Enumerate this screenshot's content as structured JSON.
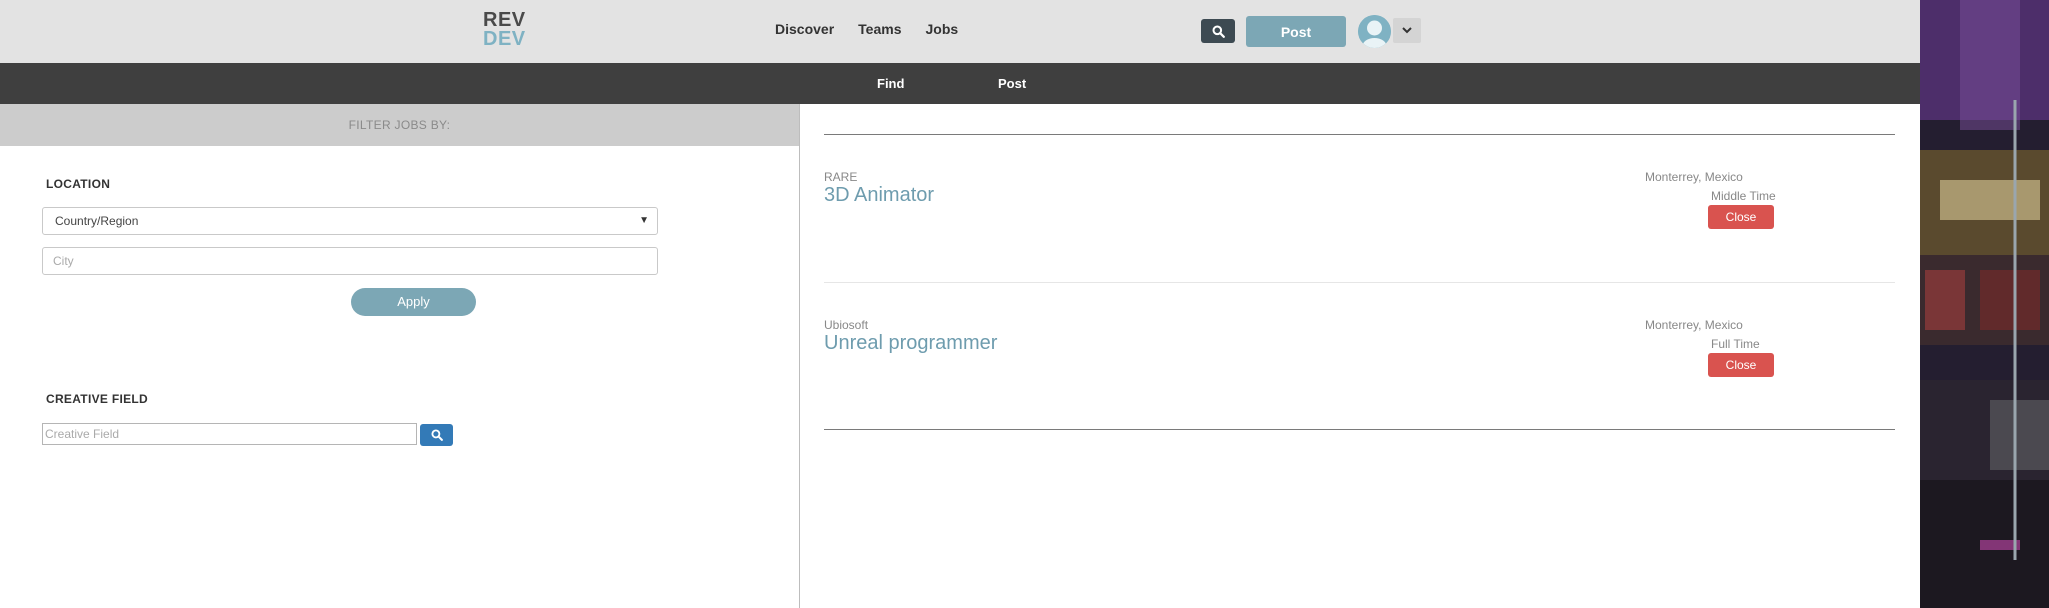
{
  "header": {
    "logo_line1": "REV",
    "logo_line2": "DEV",
    "nav": [
      "Discover",
      "Teams",
      "Jobs"
    ],
    "post_label": "Post"
  },
  "subnav": {
    "find": "Find",
    "post": "Post"
  },
  "filters": {
    "heading": "FILTER JOBS BY:",
    "location_label": "LOCATION",
    "country_select": "Country/Region",
    "city_placeholder": "City",
    "apply_label": "Apply",
    "creative_label": "CREATIVE FIELD",
    "creative_placeholder": "Creative Field"
  },
  "jobs": [
    {
      "company": "RARE",
      "title": "3D Animator",
      "location": "Monterrey, Mexico",
      "time": "Middle Time",
      "action": "Close"
    },
    {
      "company": "Ubiosoft",
      "title": "Unreal programmer",
      "location": "Monterrey, Mexico",
      "time": "Full Time",
      "action": "Close"
    }
  ],
  "colors": {
    "accent": "#7ca7b5",
    "close_button": "#d9534f",
    "search_blue": "#337ab7",
    "subnav_bg": "#3f3f3f"
  },
  "icons": [
    "search-icon",
    "user-avatar-icon",
    "chevron-down-icon",
    "caret-down-icon"
  ]
}
